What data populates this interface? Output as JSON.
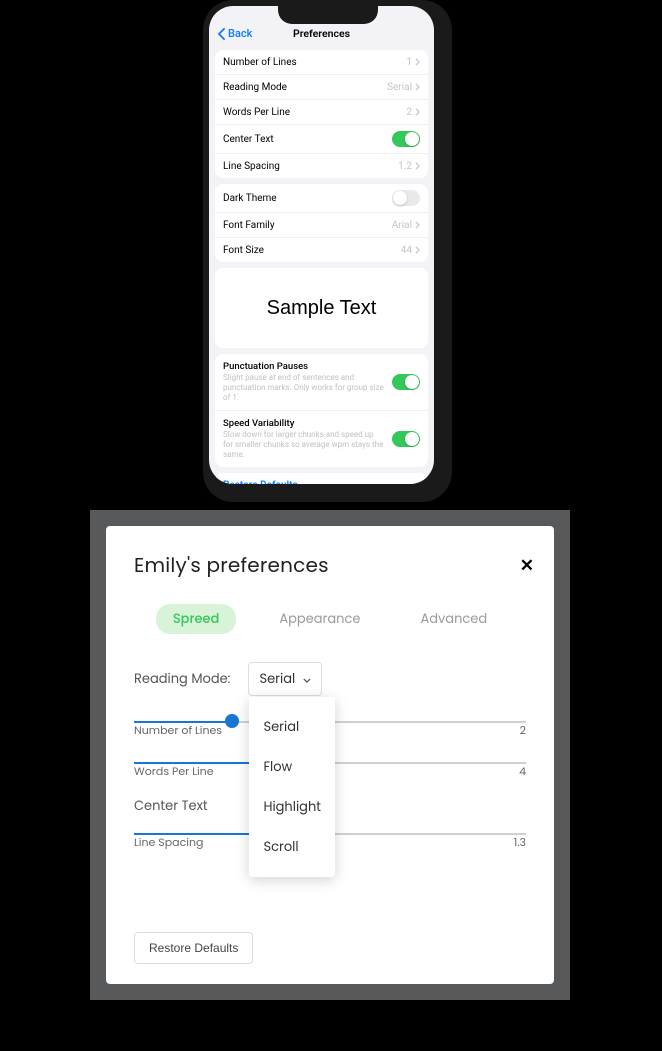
{
  "ios": {
    "back": "Back",
    "title": "Preferences",
    "group1": [
      {
        "label": "Number of Lines",
        "value": "1",
        "type": "chev"
      },
      {
        "label": "Reading Mode",
        "value": "Serial",
        "type": "chev"
      },
      {
        "label": "Words Per Line",
        "value": "2",
        "type": "chev"
      },
      {
        "label": "Center Text",
        "type": "toggle",
        "on": true
      },
      {
        "label": "Line Spacing",
        "value": "1.2",
        "type": "chev"
      }
    ],
    "group2": [
      {
        "label": "Dark Theme",
        "type": "toggle",
        "on": false
      },
      {
        "label": "Font Family",
        "value": "Arial",
        "type": "chev"
      },
      {
        "label": "Font Size",
        "value": "44",
        "type": "chev"
      }
    ],
    "sample": "Sample Text",
    "advanced": [
      {
        "title": "Punctuation Pauses",
        "desc": "Slight pause at end of sentences and punctuation marks. Only works for group size of 1.",
        "on": true
      },
      {
        "title": "Speed Variability",
        "desc": "Slow down for larger chunks and speed up for smaller chunks so average wpm stays the same.",
        "on": true
      }
    ],
    "restore": "Restore Defaults"
  },
  "web": {
    "title": "Emily's preferences",
    "tabs": [
      "Spreed",
      "Appearance",
      "Advanced"
    ],
    "active_tab": 0,
    "reading_mode_label": "Reading Mode:",
    "reading_mode_value": "Serial",
    "dropdown": [
      "Serial",
      "Flow",
      "Highlight",
      "Scroll"
    ],
    "sliders": [
      {
        "label": "Number of Lines",
        "value": "2",
        "fill": 25
      },
      {
        "label": "Words Per Line",
        "value": "4",
        "fill": 38
      }
    ],
    "center_text_label": "Center Text",
    "line_spacing": {
      "label": "Line Spacing",
      "value": "1.3",
      "fill": 32
    },
    "restore": "Restore Defaults"
  }
}
